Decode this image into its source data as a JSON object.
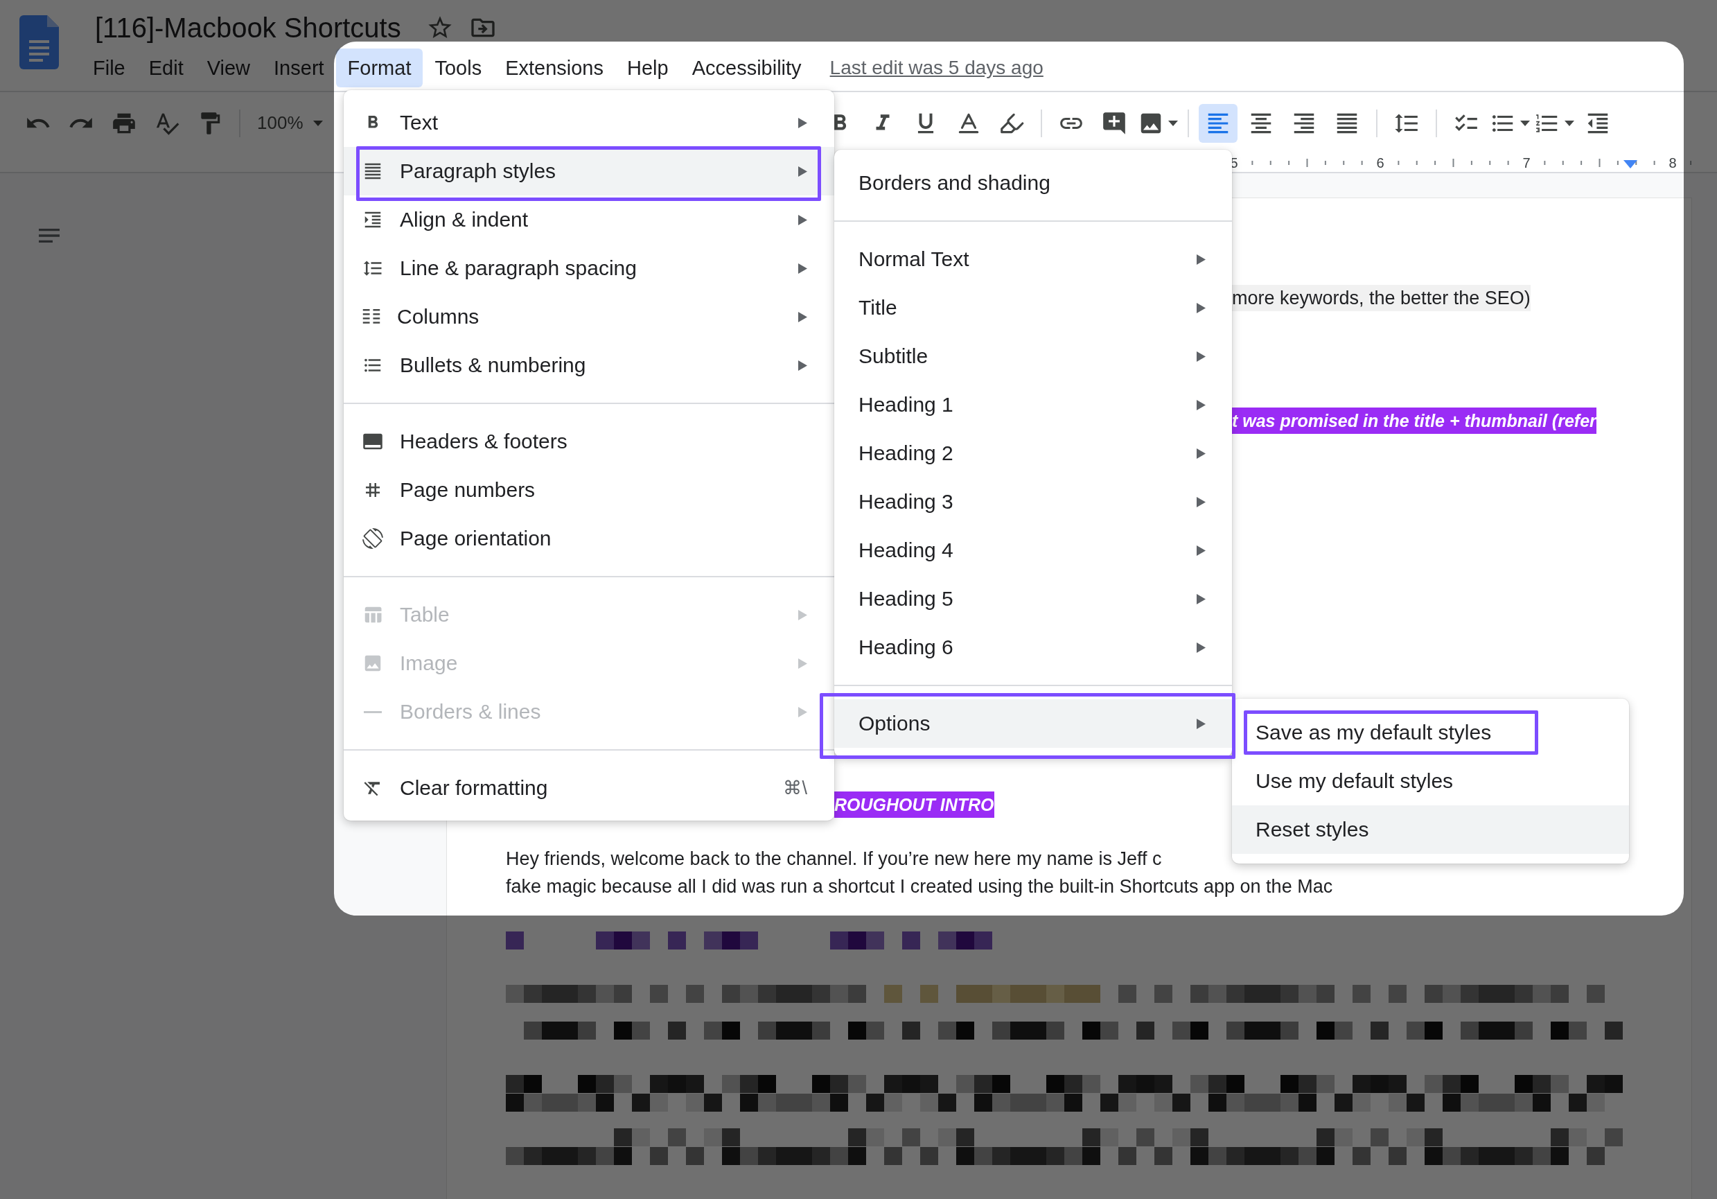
{
  "document_title": "[116]-Macbook Shortcuts",
  "menu_bar": {
    "items": [
      {
        "label": "File",
        "selected": false
      },
      {
        "label": "Edit",
        "selected": false
      },
      {
        "label": "View",
        "selected": false
      },
      {
        "label": "Insert",
        "selected": false
      },
      {
        "label": "Format",
        "selected": true
      },
      {
        "label": "Tools",
        "selected": false
      },
      {
        "label": "Extensions",
        "selected": false
      },
      {
        "label": "Help",
        "selected": false
      },
      {
        "label": "Accessibility",
        "selected": false
      }
    ],
    "last_edit": "Last edit was 5 days ago"
  },
  "toolbar": {
    "zoom": "100%",
    "alignments": [
      {
        "selected": true
      },
      {
        "selected": false
      },
      {
        "selected": false
      },
      {
        "selected": false
      }
    ]
  },
  "ruler": {
    "labels": [
      "5",
      "6",
      "7",
      "8"
    ]
  },
  "document": {
    "fragments": [
      {
        "text": "more keywords, the better the SEO)",
        "kind": "shaded"
      },
      {
        "text": "t was promised in the title + thumbnail (refer",
        "kind": "highlight"
      },
      {
        "text": "ROUGHOUT INTRO",
        "kind": "highlight"
      }
    ],
    "paragraph_lines": [
      "Hey friends, welcome back to the channel. If you’re new here my name is Jeff c",
      "fake magic because all I did was run a shortcut I created using the built-in Shortcuts app on the Mac"
    ]
  },
  "format_menu": {
    "items": [
      {
        "kind": "item",
        "label": "Text",
        "submenu": true,
        "highlighted": false,
        "disabled": false,
        "outlined": false
      },
      {
        "kind": "item",
        "label": "Paragraph styles",
        "submenu": true,
        "highlighted": true,
        "disabled": false,
        "outlined": true
      },
      {
        "kind": "item",
        "label": "Align & indent",
        "submenu": true,
        "highlighted": false,
        "disabled": false,
        "outlined": false
      },
      {
        "kind": "item",
        "label": "Line & paragraph spacing",
        "submenu": true,
        "highlighted": false,
        "disabled": false,
        "outlined": false
      },
      {
        "kind": "item",
        "label": "Columns",
        "submenu": true,
        "highlighted": false,
        "disabled": false,
        "outlined": false
      },
      {
        "kind": "item",
        "label": "Bullets & numbering",
        "submenu": true,
        "highlighted": false,
        "disabled": false,
        "outlined": false
      },
      {
        "kind": "separator"
      },
      {
        "kind": "item",
        "label": "Headers & footers",
        "submenu": false,
        "highlighted": false,
        "disabled": false,
        "outlined": false
      },
      {
        "kind": "item",
        "label": "Page numbers",
        "submenu": false,
        "highlighted": false,
        "disabled": false,
        "outlined": false
      },
      {
        "kind": "item",
        "label": "Page orientation",
        "submenu": false,
        "highlighted": false,
        "disabled": false,
        "outlined": false
      },
      {
        "kind": "separator"
      },
      {
        "kind": "item",
        "label": "Table",
        "submenu": true,
        "highlighted": false,
        "disabled": true,
        "outlined": false
      },
      {
        "kind": "item",
        "label": "Image",
        "submenu": true,
        "highlighted": false,
        "disabled": true,
        "outlined": false
      },
      {
        "kind": "item",
        "label": "Borders & lines",
        "submenu": true,
        "highlighted": false,
        "disabled": true,
        "outlined": false
      },
      {
        "kind": "separator"
      },
      {
        "kind": "item",
        "label": "Clear formatting",
        "shortcut": "⌘\\",
        "submenu": false,
        "highlighted": false,
        "disabled": false,
        "outlined": false
      }
    ]
  },
  "paragraph_styles_menu": {
    "items": [
      {
        "kind": "item",
        "label": "Borders and shading",
        "submenu": false,
        "highlighted": false,
        "outlined": false
      },
      {
        "kind": "separator"
      },
      {
        "kind": "item",
        "label": "Normal Text",
        "submenu": true,
        "highlighted": false,
        "outlined": false
      },
      {
        "kind": "item",
        "label": "Title",
        "submenu": true,
        "highlighted": false,
        "outlined": false
      },
      {
        "kind": "item",
        "label": "Subtitle",
        "submenu": true,
        "highlighted": false,
        "outlined": false
      },
      {
        "kind": "item",
        "label": "Heading 1",
        "submenu": true,
        "highlighted": false,
        "outlined": false
      },
      {
        "kind": "item",
        "label": "Heading 2",
        "submenu": true,
        "highlighted": false,
        "outlined": false
      },
      {
        "kind": "item",
        "label": "Heading 3",
        "submenu": true,
        "highlighted": false,
        "outlined": false
      },
      {
        "kind": "item",
        "label": "Heading 4",
        "submenu": true,
        "highlighted": false,
        "outlined": false
      },
      {
        "kind": "item",
        "label": "Heading 5",
        "submenu": true,
        "highlighted": false,
        "outlined": false
      },
      {
        "kind": "item",
        "label": "Heading 6",
        "submenu": true,
        "highlighted": false,
        "outlined": false
      },
      {
        "kind": "separator"
      },
      {
        "kind": "item",
        "label": "Options",
        "submenu": true,
        "highlighted": true,
        "outlined": true
      }
    ]
  },
  "options_menu": {
    "items": [
      {
        "kind": "item",
        "label": "Save as my default styles",
        "highlighted": false,
        "outlined": true
      },
      {
        "kind": "item",
        "label": "Use my default styles",
        "highlighted": false,
        "outlined": false
      },
      {
        "kind": "item",
        "label": "Reset styles",
        "highlighted": true,
        "outlined": false
      }
    ]
  }
}
